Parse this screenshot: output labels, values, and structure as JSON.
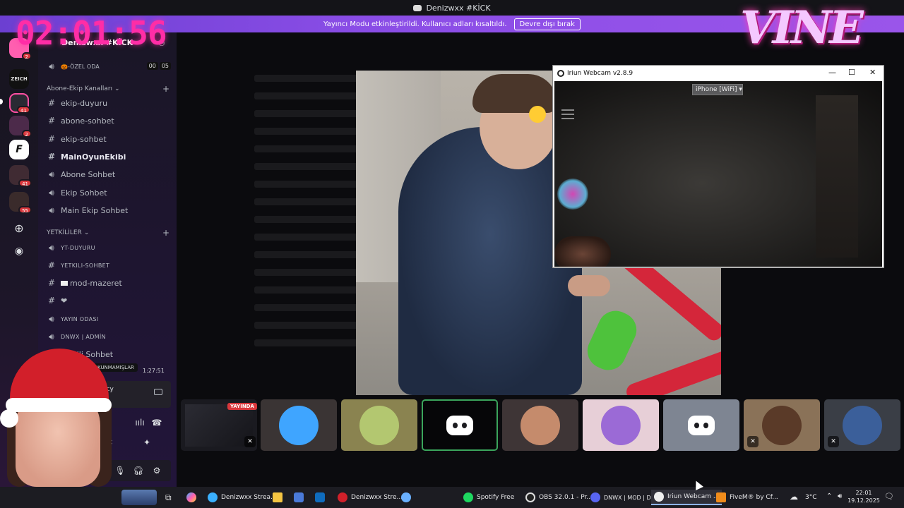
{
  "window": {
    "title": "Denizwxx #KİCK"
  },
  "notice": {
    "text": "Yayıncı Modu etkinleştirildi. Kullanıcı adları kısaltıldı.",
    "button": "Devre dışı bırak"
  },
  "overlay": {
    "timer": "02:01:56",
    "logo": "VINE"
  },
  "rail": {
    "servers": [
      {
        "badge": "2"
      },
      {
        "label": "ZEICH"
      },
      {
        "badge": "41"
      },
      {
        "badge": "2"
      },
      {
        "label": "F"
      },
      {
        "badge": "41"
      },
      {
        "badge": "55"
      }
    ]
  },
  "sidebar": {
    "server_name": "Denizwxx #KİCK",
    "private_room": {
      "label": "🎃-ÖZEL ODA",
      "count_a": "00",
      "count_b": "05"
    },
    "category_1": "Abone-Ekip Kanalları",
    "channels_1": [
      {
        "label": "ekip-duyuru",
        "icon": "hash"
      },
      {
        "label": "abone-sohbet",
        "icon": "hash"
      },
      {
        "label": "ekip-sohbet",
        "icon": "hash"
      },
      {
        "label": "MainOyunEkibi",
        "icon": "hash"
      },
      {
        "label": "Abone Sohbet",
        "icon": "speaker"
      },
      {
        "label": "Ekip Sohbet",
        "icon": "speaker"
      },
      {
        "label": "Main Ekip Sohbet",
        "icon": "speaker"
      }
    ],
    "category_2": "YETKİLİLER",
    "channels_2": [
      {
        "label": "YT-DUYURU",
        "icon": "speaker"
      },
      {
        "label": "YETKILI-SOHBET",
        "icon": "hash"
      },
      {
        "label": "mod-mazeret",
        "icon": "hash"
      },
      {
        "label": "❤",
        "icon": "hash"
      },
      {
        "label": "YAYIN ODASI",
        "icon": "speaker"
      },
      {
        "label": "DNWX | ADMİN",
        "icon": "speaker"
      },
      {
        "label": "Yetkili Sohbet",
        "icon": "speaker"
      }
    ],
    "tooltip": "NI OKUNMAMIŞLAR",
    "call_timer": "1:27:51",
    "voice_label": "acy"
  },
  "iriun": {
    "title": "Iriun Webcam v2.8.9",
    "device": "iPhone [WiFi]"
  },
  "participants": {
    "live_badge": "YAYINDA",
    "tiles": [
      {
        "bg": "#1a1a20",
        "kind": "stream"
      },
      {
        "bg": "#3a3434",
        "kind": "avatar",
        "color": "#3fa5ff"
      },
      {
        "bg": "#8a8350",
        "kind": "avatar",
        "color": "#b3c770"
      },
      {
        "bg": "#060608",
        "kind": "discord"
      },
      {
        "bg": "#3e3536",
        "kind": "avatar",
        "color": "#c58b6c"
      },
      {
        "bg": "#e7cfd7",
        "kind": "avatar",
        "color": "#9b6ad6"
      },
      {
        "bg": "#7e8592",
        "kind": "discord"
      },
      {
        "bg": "#8a7258",
        "kind": "avatar",
        "color": "#5a3a28"
      },
      {
        "bg": "#3a3e46",
        "kind": "avatar",
        "color": "#3b5f9a"
      }
    ]
  },
  "taskbar": {
    "items": [
      {
        "label": "Denizwxx Strea...",
        "color": "#3ab0ff"
      },
      {
        "label": "Denizwxx Stre...",
        "color": "#d0202a"
      },
      {
        "label": "Spotify Free",
        "color": "#1ed760"
      },
      {
        "label": "OBS 32.0.1 - Pr...",
        "color": "#dddddd"
      },
      {
        "label": "DNWX | MOD | D...",
        "color": "#5865f2"
      },
      {
        "label": "Iriun Webcam ...",
        "color": "#eeeeee"
      },
      {
        "label": "FiveM® by Cf...",
        "color": "#f08c1b"
      }
    ],
    "weather": "3°C",
    "time": "22:01",
    "date": "19.12.2025"
  }
}
